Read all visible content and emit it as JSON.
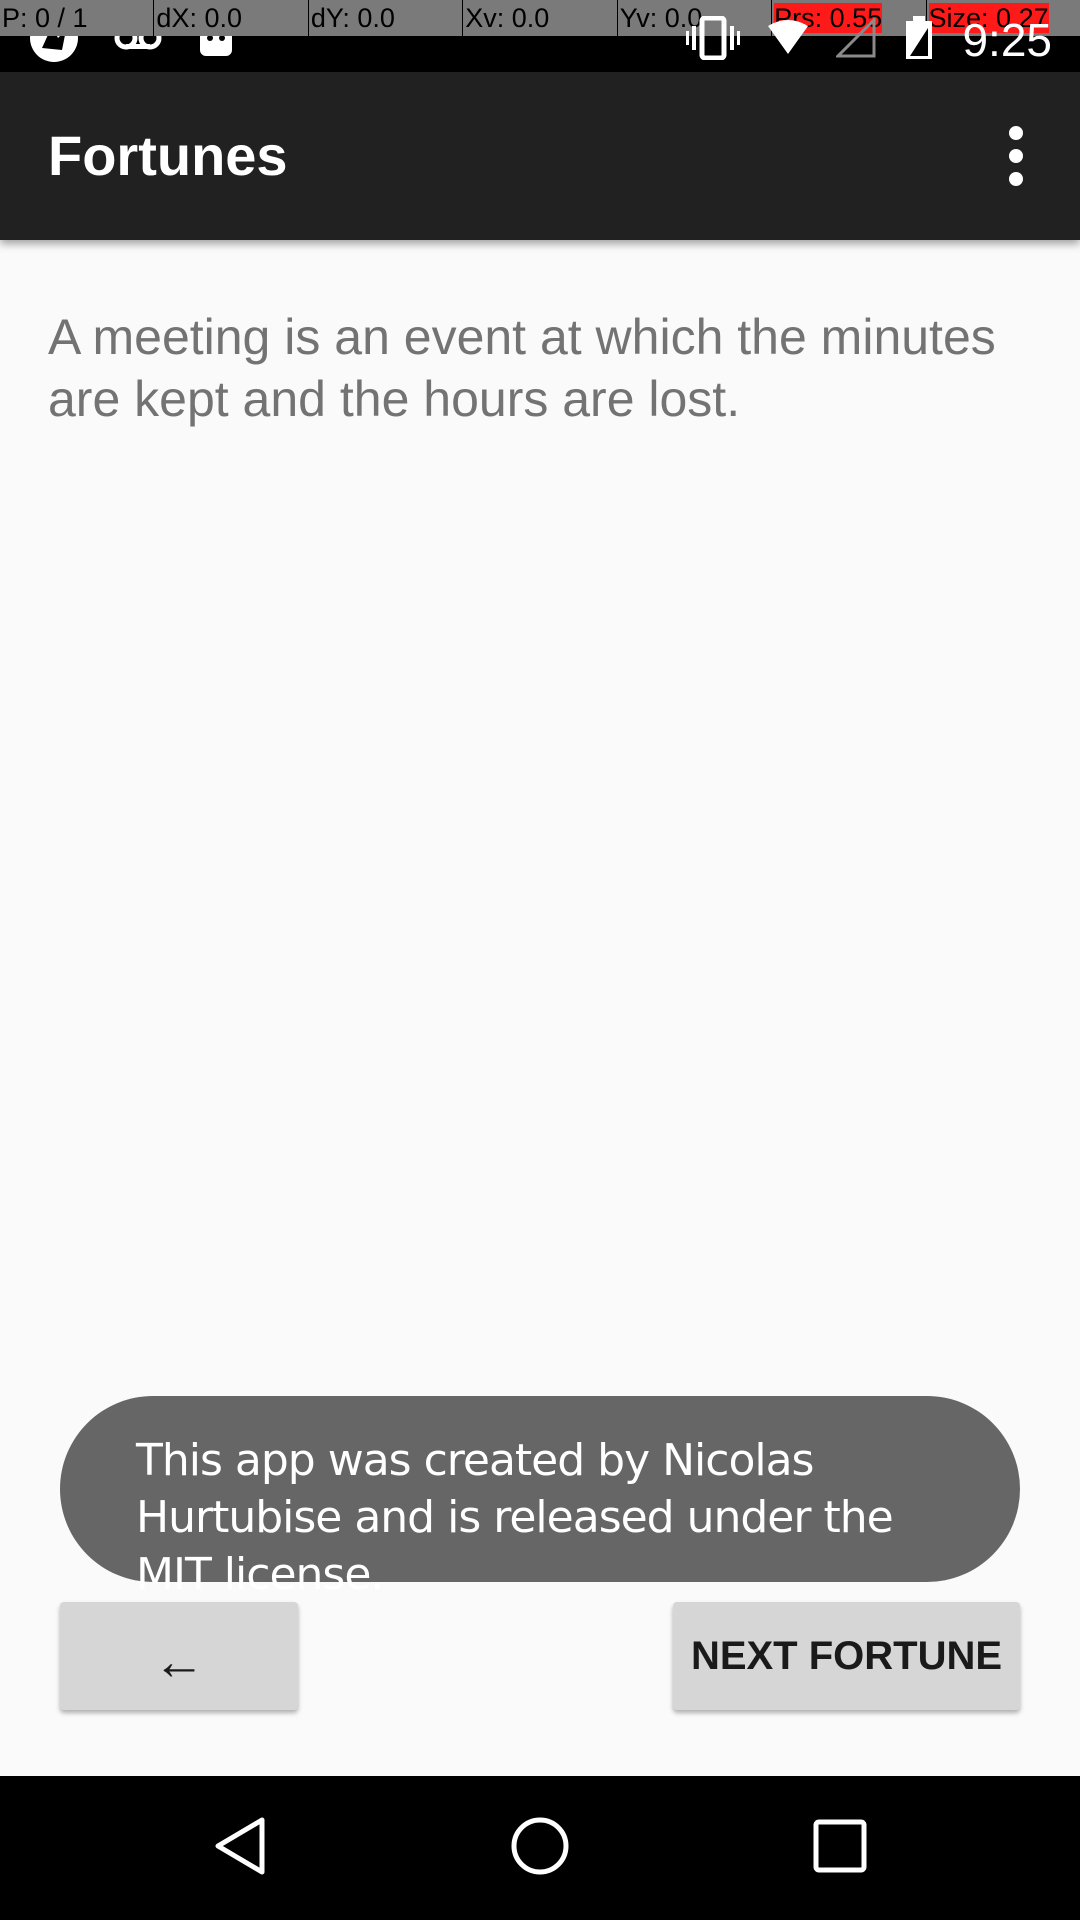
{
  "status_bar": {
    "pointer_info": [
      {
        "label": "P: 0 / 1"
      },
      {
        "label": "dX: 0.0"
      },
      {
        "label": "dY: 0.0"
      },
      {
        "label": "Xv: 0.0"
      },
      {
        "label": "Yv: 0.0"
      },
      {
        "label": "Prs: 0.55"
      },
      {
        "label": "Size: 0.27"
      }
    ],
    "time": "9:25",
    "icons": [
      "app-notification-icon",
      "voicemail-icon",
      "android-icon",
      "vibrate-icon",
      "wifi-icon",
      "signal-icon",
      "battery-icon"
    ]
  },
  "app_bar": {
    "title": "Fortunes",
    "overflow_icon": "more-vert-icon"
  },
  "content": {
    "fortune": "A meeting is an event at which the minutes are kept and the hours are lost."
  },
  "toast": {
    "message": "This app was created by Nicolas Hurtubise and is released under the MIT license."
  },
  "buttons": {
    "previous_label": "←",
    "next_label": "NEXT FORTUNE"
  },
  "nav_bar": {
    "icons": [
      "back-icon",
      "home-icon",
      "recents-icon"
    ]
  },
  "colors": {
    "app_bar": "#212121",
    "background": "#fafafa",
    "toast": "#666666",
    "button": "#d6d6d6",
    "fortune_text": "#737373"
  }
}
